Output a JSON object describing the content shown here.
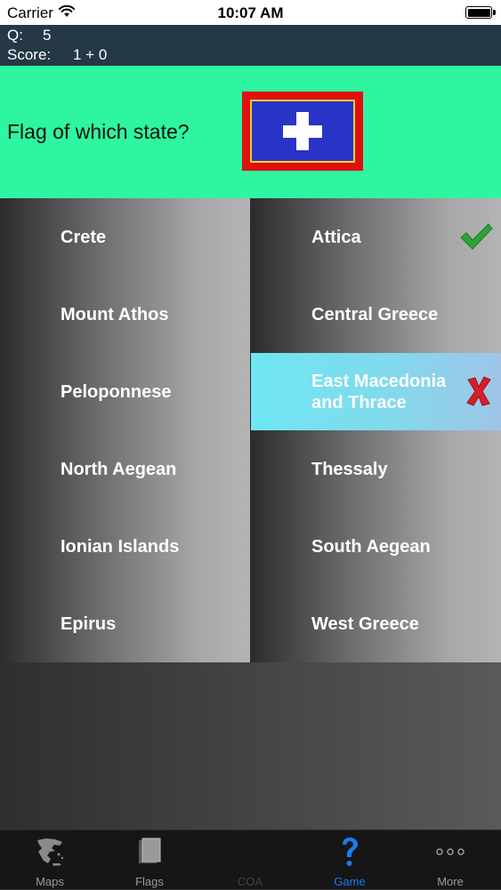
{
  "status": {
    "carrier": "Carrier",
    "time": "10:07 AM"
  },
  "score": {
    "q_label": "Q:",
    "q_value": "5",
    "score_label": "Score:",
    "score_value": "1 + 0"
  },
  "question": {
    "text": "Flag of which state?",
    "flag_colors": {
      "border": "#e01010",
      "field": "#2a33c7",
      "trim": "#f2d22a",
      "cross": "#ffffff"
    }
  },
  "answers": {
    "left": [
      {
        "label": "Crete"
      },
      {
        "label": "Mount Athos"
      },
      {
        "label": "Peloponnese"
      },
      {
        "label": "North Aegean"
      },
      {
        "label": "Ionian Islands"
      },
      {
        "label": "Epirus"
      }
    ],
    "right": [
      {
        "label": "Attica",
        "mark": "check-icon"
      },
      {
        "label": "Central Greece"
      },
      {
        "label": "East Macedonia and Thrace",
        "mark": "x-icon",
        "selected": true
      },
      {
        "label": "Thessaly"
      },
      {
        "label": "South Aegean"
      },
      {
        "label": "West Greece"
      }
    ]
  },
  "colors": {
    "question_bg": "#2ef5a0",
    "score_bg": "#243845",
    "selected_bg": "#6ee6f3",
    "correct": "#2fa335",
    "wrong": "#d81d2b",
    "tab_active": "#1a7cf0"
  },
  "tabs": [
    {
      "label": "Maps",
      "icon": "greece-map-icon"
    },
    {
      "label": "Flags",
      "icon": "flags-icon"
    },
    {
      "label": "COA",
      "icon": "coa-icon",
      "disabled": true
    },
    {
      "label": "Game",
      "icon": "question-mark-icon",
      "active": true
    },
    {
      "label": "More",
      "icon": "more-dots-icon"
    }
  ]
}
